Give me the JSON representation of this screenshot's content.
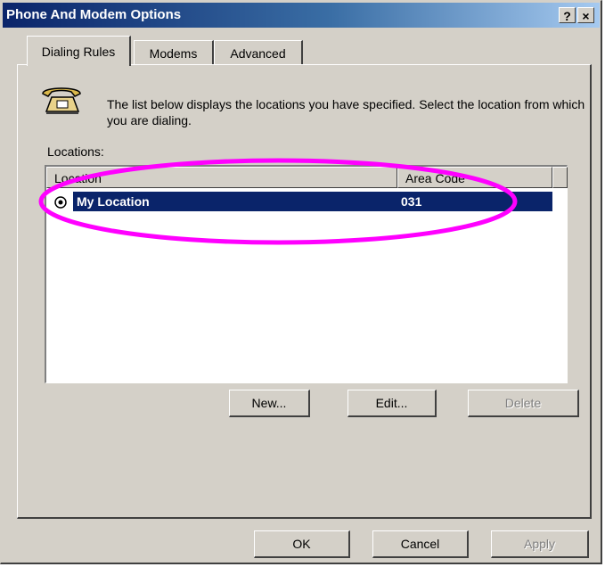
{
  "window": {
    "title": "Phone And Modem Options",
    "help_glyph": "?",
    "close_glyph": "×"
  },
  "tabs": [
    {
      "label": "Dialing Rules",
      "active": true
    },
    {
      "label": "Modems",
      "active": false
    },
    {
      "label": "Advanced",
      "active": false
    }
  ],
  "dialing_rules": {
    "icon": "telephone-icon",
    "description": "The list below displays the locations you have specified. Select the location from which you are dialing.",
    "locations_label": "Locations:",
    "columns": [
      "Location",
      "Area Code"
    ],
    "rows": [
      {
        "location": "My Location",
        "area_code": "031",
        "selected": true
      }
    ],
    "buttons": {
      "new": "New...",
      "edit": "Edit...",
      "delete": "Delete"
    }
  },
  "footer": {
    "ok": "OK",
    "cancel": "Cancel",
    "apply": "Apply"
  },
  "annotation": {
    "color": "#ff00ff"
  },
  "colors": {
    "title_bar": "#0a246a",
    "selection": "#0a246a",
    "face": "#d4d0c8"
  }
}
